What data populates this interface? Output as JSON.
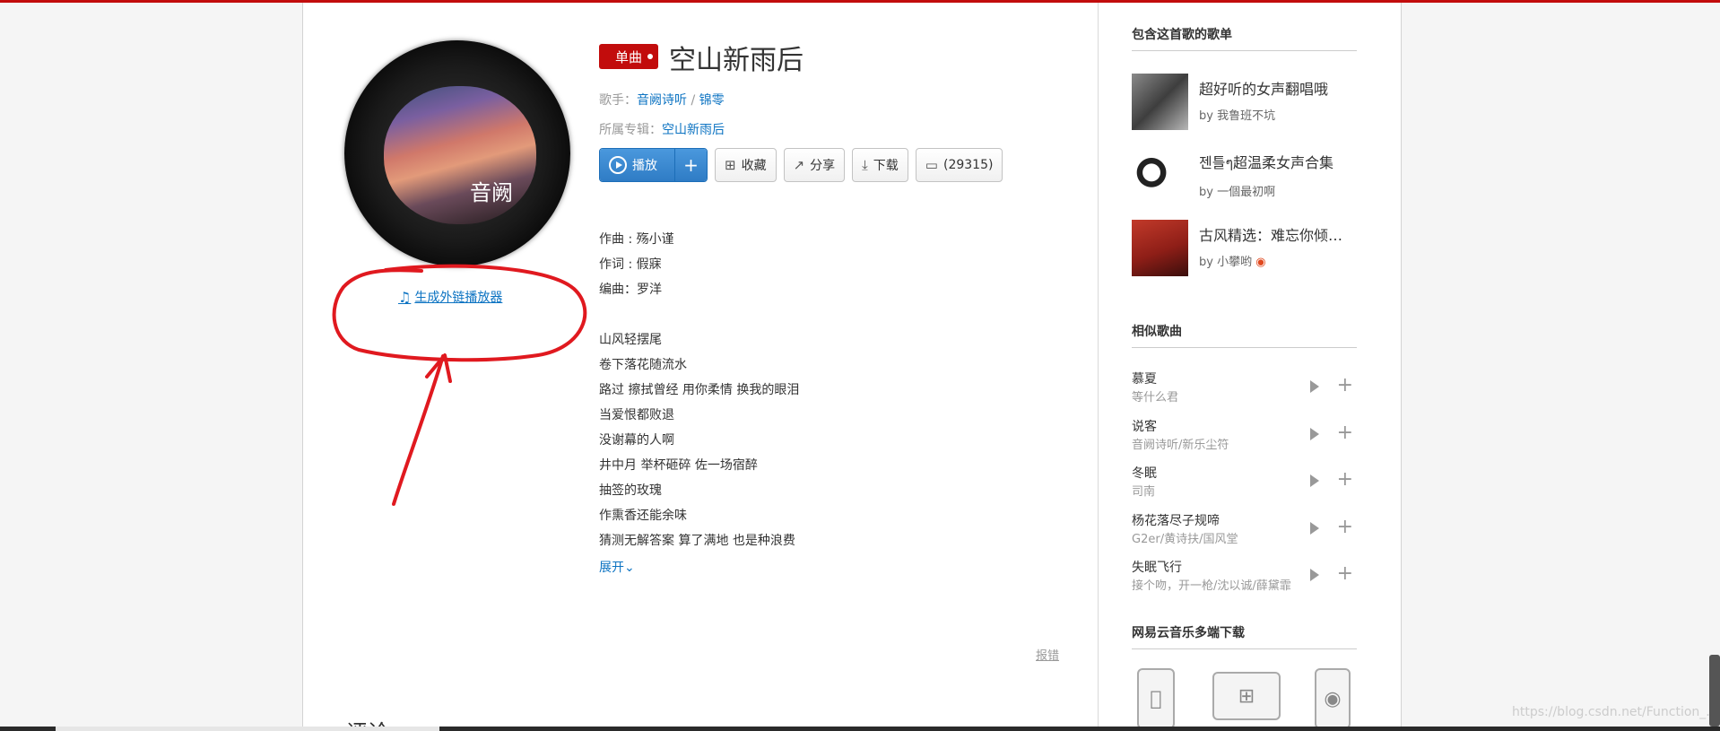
{
  "song": {
    "badge": "单曲",
    "title": "空山新雨后",
    "artist_label": "歌手：",
    "artists": [
      "音阙诗听",
      "锦零"
    ],
    "artist_sep": " / ",
    "album_label": "所属专辑：",
    "album": "空山新雨后",
    "cover_seal": "音阙"
  },
  "actions": {
    "play": "播放",
    "add": "+",
    "collect": "收藏",
    "share": "分享",
    "download": "下载",
    "comments": "(29315)"
  },
  "ext_player": "生成外链播放器",
  "lyrics": [
    "作曲 : 殇小谨",
    "作词 : 假寐",
    "编曲：罗洋",
    "",
    "山风轻摆尾",
    "卷下落花随流水",
    "路过 擦拭曾经 用你柔情 换我的眼泪",
    "当爱恨都败退",
    "没谢幕的人啊",
    "井中月 举杯砸碎 佐一场宿醉",
    "抽签的玫瑰",
    "作熏香还能余味",
    "猜测无解答案 算了满地 也是种浪费"
  ],
  "expand": "展开",
  "report": "报错",
  "comments_heading": "评论",
  "sidebar": {
    "playlists_title": "包含这首歌的歌单",
    "playlists": [
      {
        "title": "超好听的女声翻唱哦",
        "by": "by",
        "user": "我鲁班不坑"
      },
      {
        "title": "젠틀ๆ超温柔女声合集",
        "by": "by",
        "user": "一個最初啊"
      },
      {
        "title": "古风精选：难忘你倾城一笑",
        "by": "by",
        "user": "小攀哟"
      }
    ],
    "similar_title": "相似歌曲",
    "similar": [
      {
        "name": "慕夏",
        "artist": "等什么君"
      },
      {
        "name": "说客",
        "artist": "音阙诗听/新乐尘符"
      },
      {
        "name": "冬眠",
        "artist": "司南"
      },
      {
        "name": "杨花落尽子规啼",
        "artist": "G2er/黄诗扶/国风堂"
      },
      {
        "name": "失眠飞行",
        "artist": "接个吻，开一枪/沈以诚/薛黛霏"
      }
    ],
    "download_title": "网易云音乐多端下载"
  },
  "watermark": "https://blog.csdn.net/Function_...",
  "colors": {
    "brand_red": "#c20c0c",
    "link_blue": "#0c73c2",
    "annotation_red": "#e0191f"
  }
}
